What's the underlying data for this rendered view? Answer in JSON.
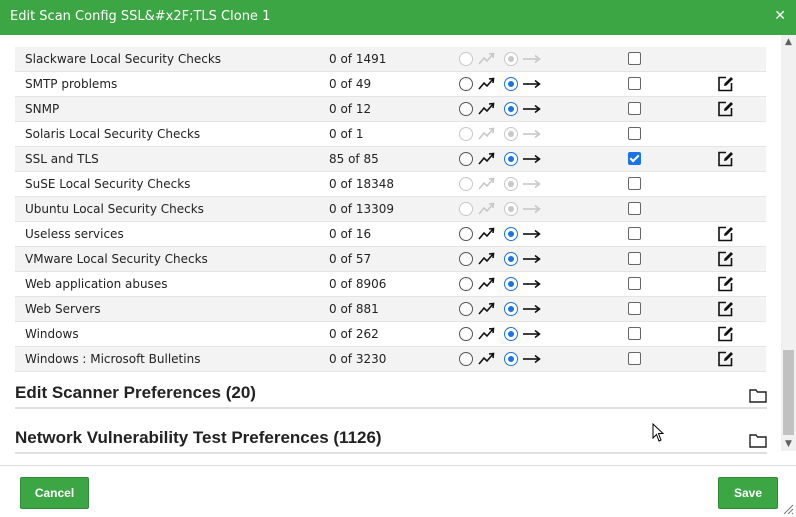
{
  "dialog": {
    "title": "Edit Scan Config SSL&#x2F;TLS Clone 1",
    "close_icon": "close-icon"
  },
  "families": [
    {
      "name": "Slackware Local Security Checks",
      "count": "0 of 1491",
      "enabled": false,
      "trend_static": true,
      "selected": false,
      "editable": false
    },
    {
      "name": "SMTP problems",
      "count": "0 of 49",
      "enabled": true,
      "trend_static": true,
      "selected": false,
      "editable": true
    },
    {
      "name": "SNMP",
      "count": "0 of 12",
      "enabled": true,
      "trend_static": true,
      "selected": false,
      "editable": true
    },
    {
      "name": "Solaris Local Security Checks",
      "count": "0 of 1",
      "enabled": false,
      "trend_static": true,
      "selected": false,
      "editable": false
    },
    {
      "name": "SSL and TLS",
      "count": "85 of 85",
      "enabled": true,
      "trend_static": true,
      "selected": true,
      "editable": true
    },
    {
      "name": "SuSE Local Security Checks",
      "count": "0 of 18348",
      "enabled": false,
      "trend_static": true,
      "selected": false,
      "editable": false
    },
    {
      "name": "Ubuntu Local Security Checks",
      "count": "0 of 13309",
      "enabled": false,
      "trend_static": true,
      "selected": false,
      "editable": false
    },
    {
      "name": "Useless services",
      "count": "0 of 16",
      "enabled": true,
      "trend_static": true,
      "selected": false,
      "editable": true
    },
    {
      "name": "VMware Local Security Checks",
      "count": "0 of 57",
      "enabled": true,
      "trend_static": true,
      "selected": false,
      "editable": true
    },
    {
      "name": "Web application abuses",
      "count": "0 of 8906",
      "enabled": true,
      "trend_static": true,
      "selected": false,
      "editable": true
    },
    {
      "name": "Web Servers",
      "count": "0 of 881",
      "enabled": true,
      "trend_static": true,
      "selected": false,
      "editable": true
    },
    {
      "name": "Windows",
      "count": "0 of 262",
      "enabled": true,
      "trend_static": true,
      "selected": false,
      "editable": true
    },
    {
      "name": "Windows : Microsoft Bulletins",
      "count": "0 of 3230",
      "enabled": true,
      "trend_static": true,
      "selected": false,
      "editable": true
    }
  ],
  "sections": [
    {
      "title": "Edit Scanner Preferences (20)"
    },
    {
      "title": "Network Vulnerability Test Preferences (1126)"
    }
  ],
  "footer": {
    "cancel_label": "Cancel",
    "save_label": "Save"
  },
  "colors": {
    "header_green": "#3ca644",
    "radio_blue": "#1a73e8"
  }
}
